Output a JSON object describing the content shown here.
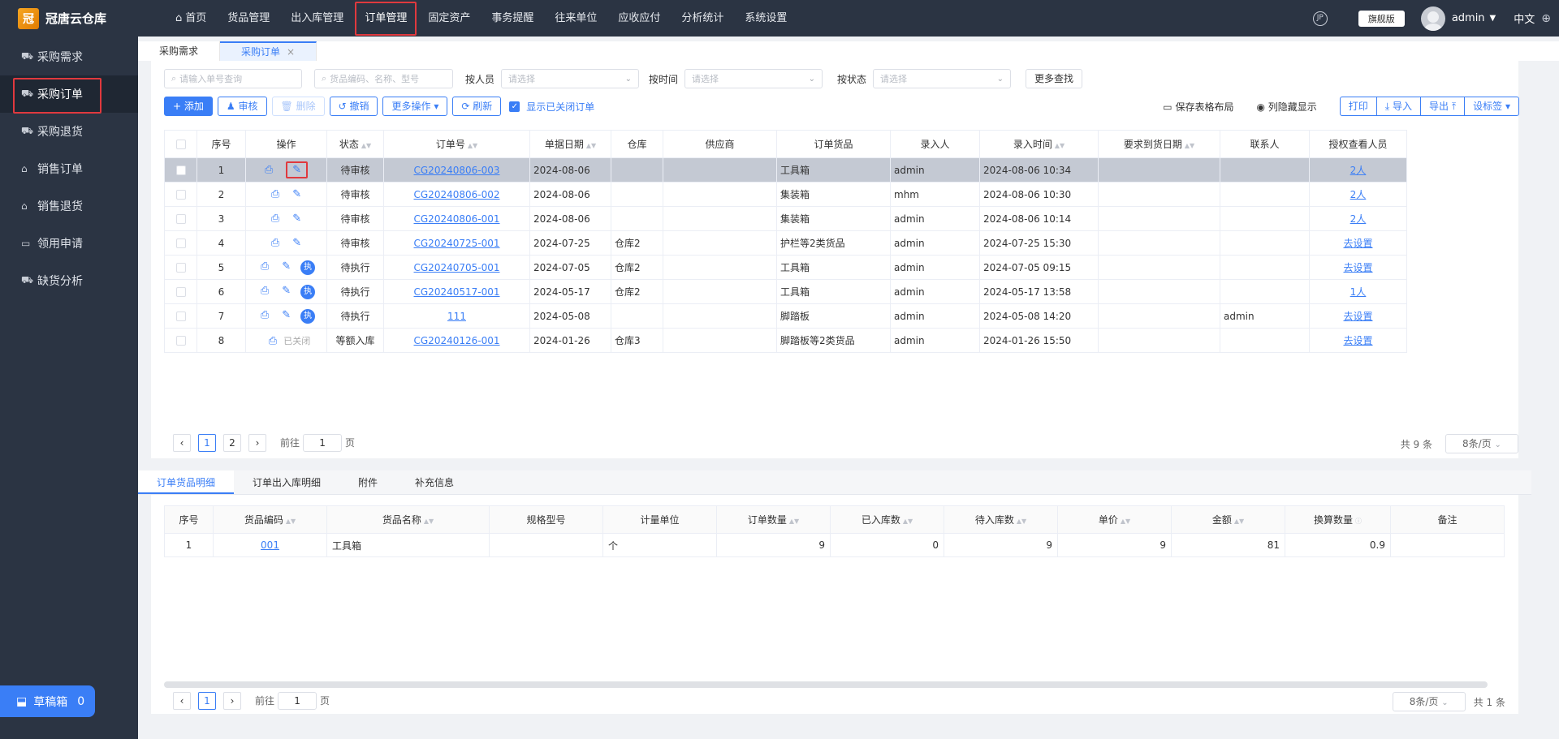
{
  "app": {
    "logo_text": "冠唐云仓库",
    "logo_mark": "冠"
  },
  "sidebar": {
    "items": [
      {
        "label": "采购需求",
        "icon": "cart-icon"
      },
      {
        "label": "采购订单",
        "icon": "cart-icon"
      },
      {
        "label": "采购退货",
        "icon": "cart-icon"
      },
      {
        "label": "销售订单",
        "icon": "bag-icon"
      },
      {
        "label": "销售退货",
        "icon": "bag-icon"
      },
      {
        "label": "领用申请",
        "icon": "box-icon"
      },
      {
        "label": "缺货分析",
        "icon": "cart-icon"
      }
    ],
    "draft": {
      "label": "草稿箱",
      "count": "0"
    }
  },
  "topnav": {
    "items": [
      "首页",
      "货品管理",
      "出入库管理",
      "订单管理",
      "固定资产",
      "事务提醒",
      "往来单位",
      "应收应付",
      "分析统计",
      "系统设置"
    ],
    "edition": "旗舰版",
    "user": "admin",
    "lang": "中文"
  },
  "tabs": [
    "采购需求",
    "采购订单"
  ],
  "filters": {
    "order_no_placeholder": "请输入单号查询",
    "goods_placeholder": "货品编码、名称、型号",
    "by_person": "按人员",
    "by_time": "按时间",
    "by_status": "按状态",
    "select_placeholder": "请选择",
    "more_search": "更多查找"
  },
  "toolbar": {
    "add": "添加",
    "approve": "审核",
    "delete": "删除",
    "revoke": "撤销",
    "more_ops": "更多操作",
    "refresh": "刷新",
    "show_closed": "显示已关闭订单",
    "save_layout": "保存表格布局",
    "hide_columns": "列隐藏显示",
    "print": "打印",
    "import": "导入",
    "export": "导出",
    "set_label": "设标签"
  },
  "table": {
    "columns": [
      "序号",
      "操作",
      "状态",
      "订单号",
      "单据日期",
      "仓库",
      "供应商",
      "订单货品",
      "录入人",
      "录入时间",
      "要求到货日期",
      "联系人",
      "授权查看人员"
    ],
    "rows": [
      {
        "no": "1",
        "status": "待审核",
        "status_kind": "pending",
        "order": "CG20240806-003",
        "date": "2024-08-06",
        "wh": "",
        "supplier": "",
        "goods": "工具箱",
        "creator": "admin",
        "time": "2024-08-06 10:34",
        "due": "",
        "contact": "",
        "auth": "2人",
        "ops": "pending"
      },
      {
        "no": "2",
        "status": "待审核",
        "status_kind": "pending",
        "order": "CG20240806-002",
        "date": "2024-08-06",
        "wh": "",
        "supplier": "",
        "goods": "集装箱",
        "creator": "mhm",
        "time": "2024-08-06 10:30",
        "due": "",
        "contact": "",
        "auth": "2人",
        "ops": "pending"
      },
      {
        "no": "3",
        "status": "待审核",
        "status_kind": "pending",
        "order": "CG20240806-001",
        "date": "2024-08-06",
        "wh": "",
        "supplier": "",
        "goods": "集装箱",
        "creator": "admin",
        "time": "2024-08-06 10:14",
        "due": "",
        "contact": "",
        "auth": "2人",
        "ops": "pending"
      },
      {
        "no": "4",
        "status": "待审核",
        "status_kind": "pending",
        "order": "CG20240725-001",
        "date": "2024-07-25",
        "wh": "仓库2",
        "supplier": "",
        "goods": "护栏等2类货品",
        "creator": "admin",
        "time": "2024-07-25 15:30",
        "due": "",
        "contact": "",
        "auth": "去设置",
        "ops": "pending"
      },
      {
        "no": "5",
        "status": "待执行",
        "status_kind": "exec",
        "order": "CG20240705-001",
        "date": "2024-07-05",
        "wh": "仓库2",
        "supplier": "",
        "goods": "工具箱",
        "creator": "admin",
        "time": "2024-07-05 09:15",
        "due": "",
        "contact": "",
        "auth": "去设置",
        "ops": "exec"
      },
      {
        "no": "6",
        "status": "待执行",
        "status_kind": "exec",
        "order": "CG20240517-001",
        "date": "2024-05-17",
        "wh": "仓库2",
        "supplier": "",
        "goods": "工具箱",
        "creator": "admin",
        "time": "2024-05-17 13:58",
        "due": "",
        "contact": "",
        "auth": "1人",
        "ops": "exec"
      },
      {
        "no": "7",
        "status": "待执行",
        "status_kind": "exec",
        "order": "111",
        "date": "2024-05-08",
        "wh": "",
        "supplier": "",
        "goods": "脚踏板",
        "creator": "admin",
        "time": "2024-05-08 14:20",
        "due": "",
        "contact": "admin",
        "auth": "去设置",
        "ops": "exec"
      },
      {
        "no": "8",
        "status": "等额入库",
        "status_kind": "plain",
        "order": "CG20240126-001",
        "date": "2024-01-26",
        "wh": "仓库3",
        "supplier": "",
        "goods": "脚踏板等2类货品",
        "creator": "admin",
        "time": "2024-01-26 15:50",
        "due": "",
        "contact": "",
        "auth": "去设置",
        "ops": "closed"
      }
    ],
    "exec_badge": "执",
    "closed_label": "已关闭"
  },
  "pager": {
    "pages": [
      "1",
      "2"
    ],
    "goto_prefix": "前往",
    "goto_value": "1",
    "goto_suffix": "页",
    "total": "共 9 条",
    "size": "8条/页"
  },
  "bottom": {
    "tabs": [
      "订单货品明细",
      "订单出入库明细",
      "附件",
      "补充信息"
    ],
    "columns": [
      "序号",
      "货品编码",
      "货品名称",
      "规格型号",
      "计量单位",
      "订单数量",
      "已入库数",
      "待入库数",
      "单价",
      "金额",
      "换算数量",
      "备注"
    ],
    "rows": [
      {
        "no": "1",
        "code": "001",
        "name": "工具箱",
        "spec": "",
        "unit": "个",
        "qty": "9",
        "in": "0",
        "pending": "9",
        "price": "9",
        "amount": "81",
        "conv": "0.9",
        "remark": ""
      }
    ],
    "pager": {
      "page": "1",
      "goto_prefix": "前往",
      "goto_value": "1",
      "goto_suffix": "页",
      "size": "8条/页",
      "total": "共 1 条"
    }
  }
}
